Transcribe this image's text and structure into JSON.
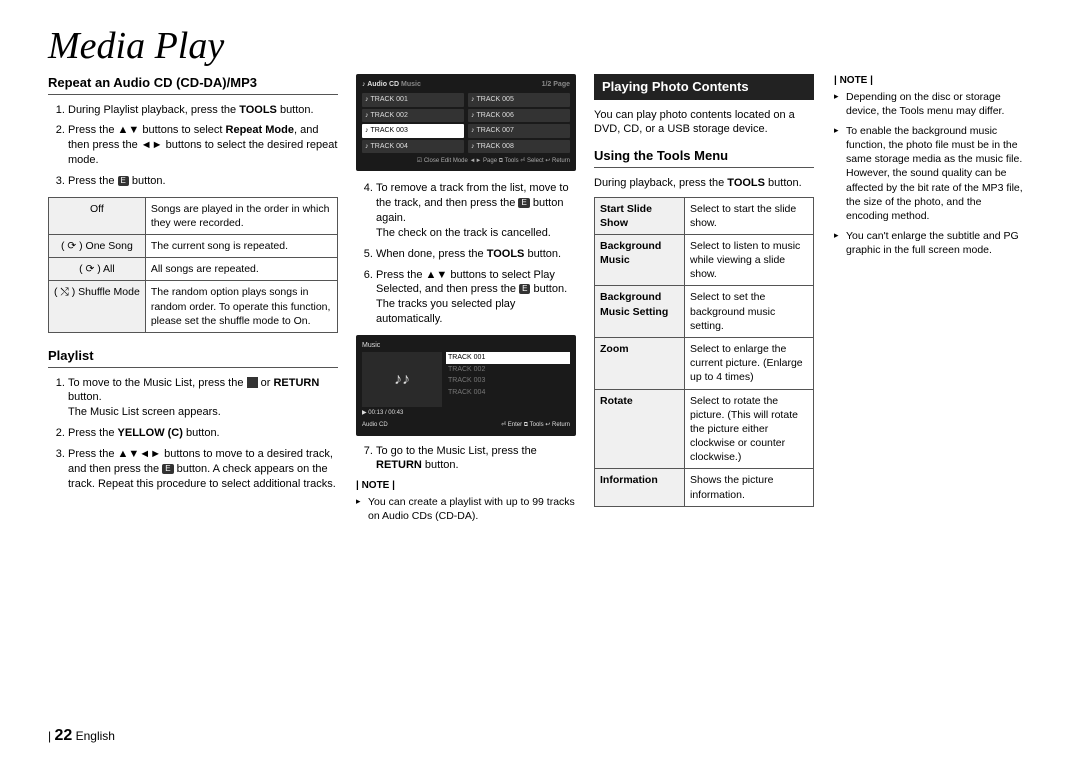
{
  "page": {
    "title": "Media Play",
    "number": "22",
    "language": "English"
  },
  "col1": {
    "header": "Repeat an Audio CD (CD-DA)/MP3",
    "steps": [
      {
        "pre": "During Playlist playback, press the ",
        "bold": "TOOLS",
        "post": " button."
      },
      {
        "pre": "Press the ▲▼ buttons to select ",
        "bold": "Repeat Mode",
        "post": ", and then press the ◄► buttons to select the desired repeat mode."
      },
      {
        "pre": "Press the ",
        "icon": "E",
        "post": " button."
      }
    ],
    "table": [
      {
        "mode": "Off",
        "desc": "Songs are played in the order in which they were recorded."
      },
      {
        "mode": "( ⟳ ) One Song",
        "desc": "The current song is repeated."
      },
      {
        "mode": "( ⟳ ) All",
        "desc": "All songs are repeated."
      },
      {
        "mode": "( ⤭ ) Shuffle Mode",
        "desc": "The random option plays songs in random order. To operate this function, please set the shuffle mode to On."
      }
    ],
    "playlist": {
      "header": "Playlist",
      "steps": [
        "To move to the Music List, press the ■ or RETURN button.\nThe Music List screen appears.",
        "Press the YELLOW (C) button.",
        "Press the ▲▼◄► buttons to move to a desired track, and then press the E button. A check appears on the track. Repeat this procedure to select additional tracks."
      ]
    }
  },
  "col2": {
    "shot1": {
      "title": "Audio CD",
      "sub": "Music",
      "tracks_left": [
        "TRACK 001",
        "TRACK 002",
        "TRACK 003",
        "TRACK 004"
      ],
      "tracks_right": [
        "TRACK 005",
        "TRACK 006",
        "TRACK 007",
        "TRACK 008"
      ],
      "foot": "☑ Close Edit Mode   ◄► Page   ⧉ Tools   ⏎ Select   ↩ Return"
    },
    "steps_a": [
      "To remove a track from the list, move to the track, and then press the E button again.\nThe check on the track is cancelled.",
      "When done, press the TOOLS button.",
      "Press the ▲▼ buttons to select Play Selected, and then press the E button.\nThe tracks you selected play automatically."
    ],
    "shot2": {
      "topbar": "Music",
      "now": "TRACK 001",
      "list": [
        "TRACK 001",
        "TRACK 002",
        "TRACK 003",
        "TRACK 004"
      ],
      "time": "00:13 / 00:43",
      "footL": "Audio CD",
      "footR": "⏎ Enter   ⧉ Tools   ↩ Return"
    },
    "step7": "To go to the Music List, press the RETURN button.",
    "noteHdr": "| NOTE |",
    "note": "You can create a playlist with up to 99 tracks on Audio CDs (CD-DA)."
  },
  "col3": {
    "blackHdr": "Playing Photo Contents",
    "intro": "You can play photo contents located on a DVD, CD, or a USB storage device.",
    "subHdr": "Using the Tools Menu",
    "subIntro_pre": "During playback, press the ",
    "subIntro_bold": "TOOLS",
    "subIntro_post": " button.",
    "tools": [
      {
        "k": "Start Slide Show",
        "v": "Select to start the slide show."
      },
      {
        "k": "Background Music",
        "v": "Select to listen to music while viewing a slide show."
      },
      {
        "k": "Background Music Setting",
        "v": "Select to set the background music setting."
      },
      {
        "k": "Zoom",
        "v": "Select to enlarge the current picture. (Enlarge up to 4 times)"
      },
      {
        "k": "Rotate",
        "v": "Select to rotate the picture. (This will rotate the picture either clockwise or counter clockwise.)"
      },
      {
        "k": "Information",
        "v": "Shows the picture information."
      }
    ],
    "noteHdr": "| NOTE |",
    "notes": [
      "Depending on the disc or storage device, the Tools menu may differ.",
      "To enable the background music function, the photo file must be in the same storage media as the music file.\nHowever, the sound quality can be affected by the bit rate of the MP3 file, the size of the photo, and the encoding method.",
      "You can't enlarge the subtitle and PG graphic in the full screen mode."
    ]
  }
}
